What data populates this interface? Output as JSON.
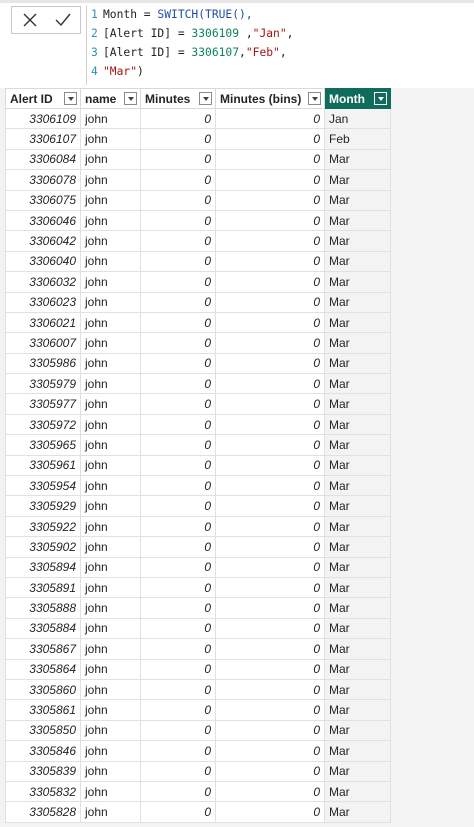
{
  "formula_bar": {
    "lines": [
      {
        "num": "1",
        "parts": [
          {
            "t": "Month = ",
            "c": "op"
          },
          {
            "t": "SWITCH(TRUE(),",
            "c": "kw"
          }
        ]
      },
      {
        "num": "2",
        "parts": [
          {
            "t": "[Alert ID] = ",
            "c": "op"
          },
          {
            "t": "3306109",
            "c": "num"
          },
          {
            "t": " ,",
            "c": "op"
          },
          {
            "t": "\"Jan\"",
            "c": "str"
          },
          {
            "t": ",",
            "c": "op"
          }
        ]
      },
      {
        "num": "3",
        "parts": [
          {
            "t": "[Alert ID] = ",
            "c": "op"
          },
          {
            "t": "3306107",
            "c": "num"
          },
          {
            "t": ",",
            "c": "op"
          },
          {
            "t": "\"Feb\"",
            "c": "str"
          },
          {
            "t": ",",
            "c": "op"
          }
        ]
      },
      {
        "num": "4",
        "parts": [
          {
            "t": "\"Mar\"",
            "c": "str"
          },
          {
            "t": ")",
            "c": "op"
          }
        ]
      }
    ]
  },
  "table": {
    "columns": [
      {
        "label": "Alert ID",
        "key": "id"
      },
      {
        "label": "name",
        "key": "name"
      },
      {
        "label": "Minutes",
        "key": "min"
      },
      {
        "label": "Minutes (bins)",
        "key": "bins"
      },
      {
        "label": "Month",
        "key": "month",
        "active": true
      }
    ],
    "rows": [
      [
        "3306109",
        "john",
        "0",
        "0",
        "Jan"
      ],
      [
        "3306107",
        "john",
        "0",
        "0",
        "Feb"
      ],
      [
        "3306084",
        "john",
        "0",
        "0",
        "Mar"
      ],
      [
        "3306078",
        "john",
        "0",
        "0",
        "Mar"
      ],
      [
        "3306075",
        "john",
        "0",
        "0",
        "Mar"
      ],
      [
        "3306046",
        "john",
        "0",
        "0",
        "Mar"
      ],
      [
        "3306042",
        "john",
        "0",
        "0",
        "Mar"
      ],
      [
        "3306040",
        "john",
        "0",
        "0",
        "Mar"
      ],
      [
        "3306032",
        "john",
        "0",
        "0",
        "Mar"
      ],
      [
        "3306023",
        "john",
        "0",
        "0",
        "Mar"
      ],
      [
        "3306021",
        "john",
        "0",
        "0",
        "Mar"
      ],
      [
        "3306007",
        "john",
        "0",
        "0",
        "Mar"
      ],
      [
        "3305986",
        "john",
        "0",
        "0",
        "Mar"
      ],
      [
        "3305979",
        "john",
        "0",
        "0",
        "Mar"
      ],
      [
        "3305977",
        "john",
        "0",
        "0",
        "Mar"
      ],
      [
        "3305972",
        "john",
        "0",
        "0",
        "Mar"
      ],
      [
        "3305965",
        "john",
        "0",
        "0",
        "Mar"
      ],
      [
        "3305961",
        "john",
        "0",
        "0",
        "Mar"
      ],
      [
        "3305954",
        "john",
        "0",
        "0",
        "Mar"
      ],
      [
        "3305929",
        "john",
        "0",
        "0",
        "Mar"
      ],
      [
        "3305922",
        "john",
        "0",
        "0",
        "Mar"
      ],
      [
        "3305902",
        "john",
        "0",
        "0",
        "Mar"
      ],
      [
        "3305894",
        "john",
        "0",
        "0",
        "Mar"
      ],
      [
        "3305891",
        "john",
        "0",
        "0",
        "Mar"
      ],
      [
        "3305888",
        "john",
        "0",
        "0",
        "Mar"
      ],
      [
        "3305884",
        "john",
        "0",
        "0",
        "Mar"
      ],
      [
        "3305867",
        "john",
        "0",
        "0",
        "Mar"
      ],
      [
        "3305864",
        "john",
        "0",
        "0",
        "Mar"
      ],
      [
        "3305860",
        "john",
        "0",
        "0",
        "Mar"
      ],
      [
        "3305861",
        "john",
        "0",
        "0",
        "Mar"
      ],
      [
        "3305850",
        "john",
        "0",
        "0",
        "Mar"
      ],
      [
        "3305846",
        "john",
        "0",
        "0",
        "Mar"
      ],
      [
        "3305839",
        "john",
        "0",
        "0",
        "Mar"
      ],
      [
        "3305832",
        "john",
        "0",
        "0",
        "Mar"
      ],
      [
        "3305828",
        "john",
        "0",
        "0",
        "Mar"
      ]
    ]
  },
  "icons": {
    "cancel": "close-icon",
    "commit": "checkmark-icon",
    "filter": "chevron-down-icon"
  },
  "colors": {
    "active_header": "#0f6b5c"
  }
}
